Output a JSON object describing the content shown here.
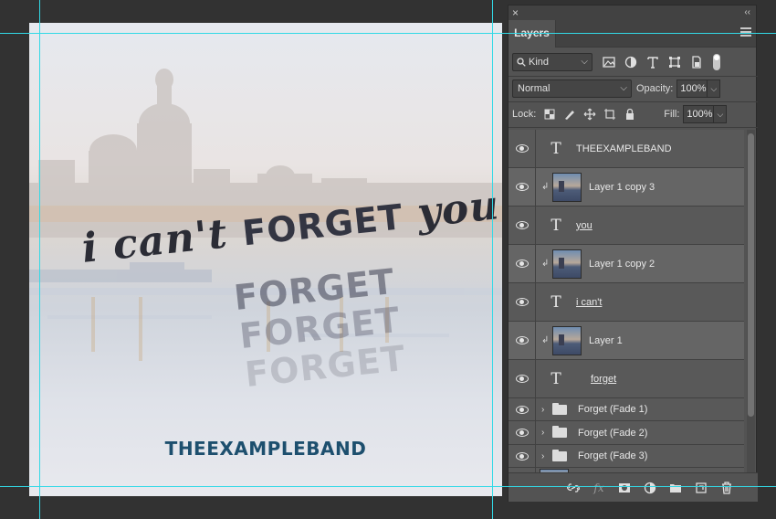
{
  "canvas": {
    "hero_lowercase_1": "i can't",
    "hero_caps": "FORGET",
    "hero_lowercase_2": "you",
    "fade_1": "FORGET",
    "fade_2": "FORGET",
    "fade_3": "FORGET",
    "band_name": "THEEXAMPLEBAND"
  },
  "panel": {
    "close_glyph": "×",
    "collapse_glyph": "‹‹",
    "tab_label": "Layers",
    "kind_filter": "Kind",
    "blend_mode": "Normal",
    "opacity_label": "Opacity:",
    "opacity_value": "100%",
    "lock_label": "Lock:",
    "fill_label": "Fill:",
    "fill_value": "100%"
  },
  "layers": [
    {
      "name": "THEEXAMPLEBAND",
      "type": "text"
    },
    {
      "name": "Layer 1 copy 3",
      "type": "image",
      "clipped": true
    },
    {
      "name": "you",
      "type": "text"
    },
    {
      "name": "Layer 1 copy 2",
      "type": "image",
      "clipped": true
    },
    {
      "name": "i can't",
      "type": "text"
    },
    {
      "name": "Layer 1",
      "type": "image",
      "clipped": true
    },
    {
      "name": "forget",
      "type": "text"
    },
    {
      "name": "Forget (Fade 1)",
      "type": "group"
    },
    {
      "name": "Forget (Fade 2)",
      "type": "group"
    },
    {
      "name": "Forget (Fade 3)",
      "type": "group"
    }
  ],
  "icons": {
    "filter": [
      "image-filter-icon",
      "adjustment-filter-icon",
      "type-filter-icon",
      "shape-filter-icon",
      "smart-object-filter-icon"
    ],
    "lock": [
      "lock-transparent-icon",
      "lock-image-icon",
      "lock-position-icon",
      "lock-artboard-icon",
      "lock-all-icon"
    ],
    "bottom": [
      "link-icon",
      "fx-icon",
      "mask-icon",
      "adjustment-icon",
      "new-group-icon",
      "new-layer-icon",
      "trash-icon"
    ]
  },
  "colors": {
    "band_text": "#1d4f6e",
    "guide": "#32d9e6",
    "panel_bg": "#535353",
    "app_bg": "#323232"
  }
}
